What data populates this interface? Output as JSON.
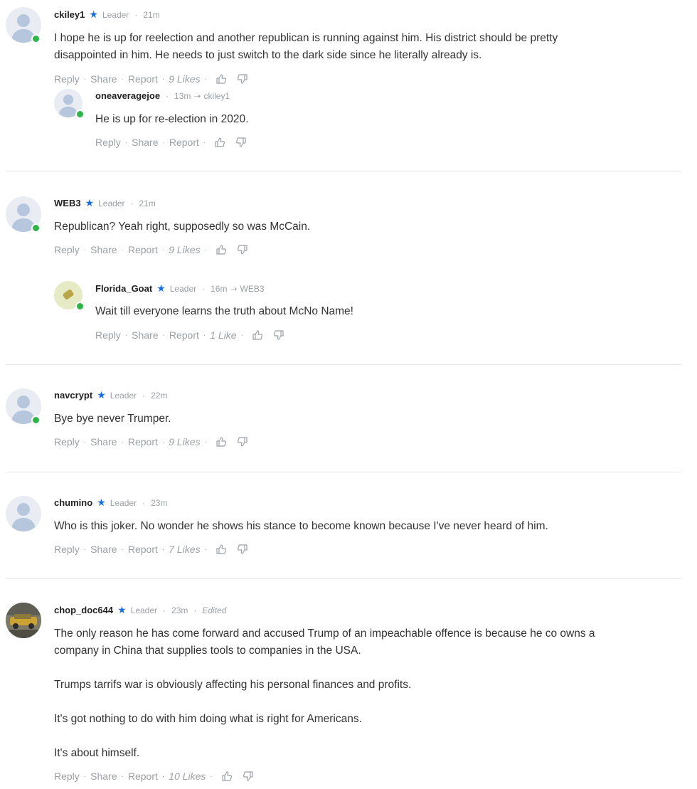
{
  "comments": [
    {
      "username": "ckiley1",
      "badge": "Leader",
      "time": "21m",
      "text": [
        "I hope he is up for reelection and another republican is running against him. His district should be pretty",
        "disappointed in him. He needs to just switch to the dark side since he literally already is."
      ],
      "actions": {
        "reply": "Reply",
        "share": "Share",
        "report": "Report",
        "likes": "9 Likes"
      },
      "reply": {
        "username": "oneaveragejoe",
        "time": "13m",
        "reply_to": "ckiley1",
        "text": "He is up for re-election in 2020.",
        "actions": {
          "reply": "Reply",
          "share": "Share",
          "report": "Report"
        }
      }
    },
    {
      "username": "WEB3",
      "badge": "Leader",
      "time": "21m",
      "text": "Republican? Yeah right, supposedly so was McCain.",
      "actions": {
        "reply": "Reply",
        "share": "Share",
        "report": "Report",
        "likes": "9 Likes"
      },
      "reply": {
        "username": "Florida_Goat",
        "badge": "Leader",
        "time": "16m",
        "reply_to": "WEB3",
        "text": "Wait till everyone learns the truth about McNo Name!",
        "actions": {
          "reply": "Reply",
          "share": "Share",
          "report": "Report",
          "likes": "1 Like"
        }
      }
    },
    {
      "username": "navcrypt",
      "badge": "Leader",
      "time": "22m",
      "text": "Bye bye never Trumper.",
      "actions": {
        "reply": "Reply",
        "share": "Share",
        "report": "Report",
        "likes": "9 Likes"
      }
    },
    {
      "username": "chumino",
      "badge": "Leader",
      "time": "23m",
      "text": "Who is this joker. No wonder he shows his stance to become known because I've never heard of him.",
      "actions": {
        "reply": "Reply",
        "share": "Share",
        "report": "Report",
        "likes": "7 Likes"
      }
    },
    {
      "username": "chop_doc644",
      "badge": "Leader",
      "time": "23m",
      "edited": "Edited",
      "text": [
        "The only reason he has come forward and accused Trump of an impeachable offence is because he co owns a",
        "company in China that supplies tools to companies in the USA.",
        "Trumps tarrifs war is obviously affecting his personal finances and profits.",
        "It's got nothing to do with him doing what is right for Americans.",
        "It's about himself."
      ],
      "actions": {
        "reply": "Reply",
        "share": "Share",
        "report": "Report",
        "likes": "10 Likes"
      }
    }
  ],
  "icons": {
    "online_dot": "online-status-dot",
    "star": "leader-star-icon",
    "arrow": "reply-arrow-icon",
    "like": "thumbs-up-icon",
    "dislike": "thumbs-down-icon"
  },
  "colors": {
    "online": "#2fb34a",
    "star": "#1a6fe0",
    "muted": "#9aa0a6"
  }
}
